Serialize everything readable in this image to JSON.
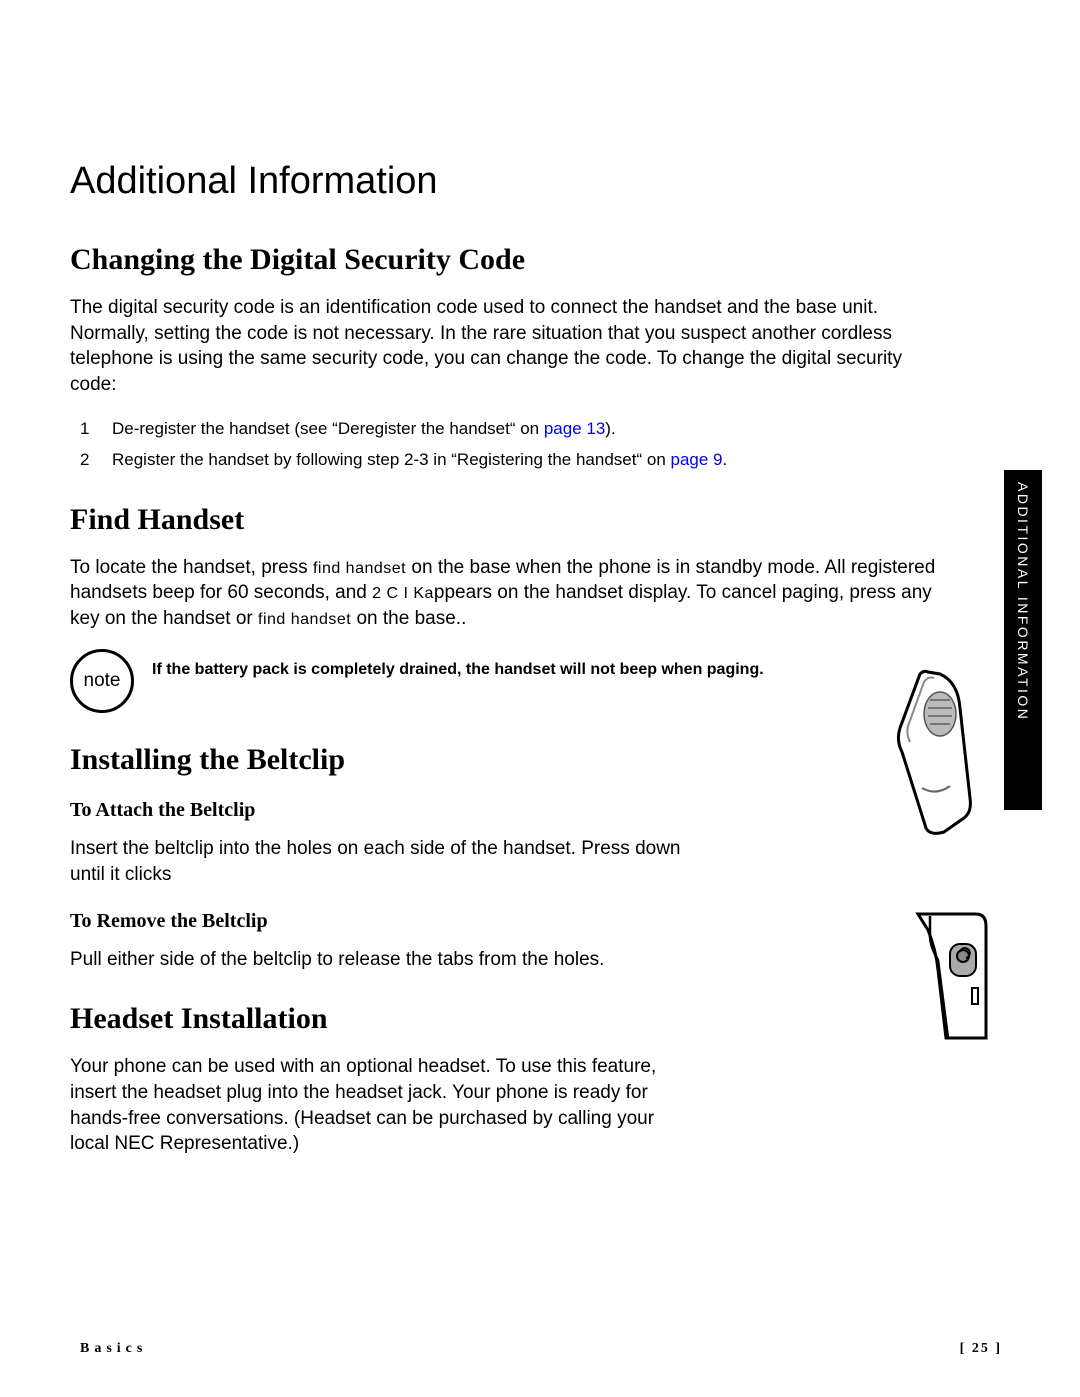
{
  "title": "Additional Information",
  "section1": {
    "heading": "Changing the Digital Security Code",
    "body": "The digital security code is an identification code used to connect the handset and the base unit. Normally, setting the code is not necessary. In the rare situation that you suspect another cordless telephone is using the same security code, you can change the code. To change the digital security code:",
    "step1_a": "De-register the handset (see “Deregister the handset“ on ",
    "step1_link": "page 13",
    "step1_b": ").",
    "step2_a": "Register the handset by following step 2-3 in “Registering the handset“ on ",
    "step2_link": "page 9",
    "step2_b": "."
  },
  "section2": {
    "heading": "Find Handset",
    "body_a": "To locate the handset, press ",
    "key1": "find handset",
    "body_b": " on the base when the phone is in standby mode. All registered handsets beep for 60 seconds, and ",
    "display": "2 C I Ka",
    "body_c": "ppears on the handset display. To cancel paging, press any key on the handset or ",
    "key2": "find handset",
    "body_d": " on the base.."
  },
  "note": {
    "label": "note",
    "text": "If the battery pack is completely drained, the handset will not beep when paging."
  },
  "section3": {
    "heading": "Installing the Beltclip",
    "sub1": "To Attach the Beltclip",
    "body1": "Insert the beltclip into the holes on each side of the handset. Press down until it clicks",
    "sub2": "To Remove the Beltclip",
    "body2": "Pull either side of the beltclip to release the tabs from the holes."
  },
  "section4": {
    "heading": "Headset Installation",
    "body": "Your phone can be used with an optional headset. To use this feature, insert the headset plug into the headset jack. Your phone is ready for hands-free conversations. (Headset can be purchased by calling your local NEC Representative.)"
  },
  "side_tab": "ADDITIONAL INFORMATION",
  "footer_left": "Basics",
  "footer_right": "[ 25 ]"
}
